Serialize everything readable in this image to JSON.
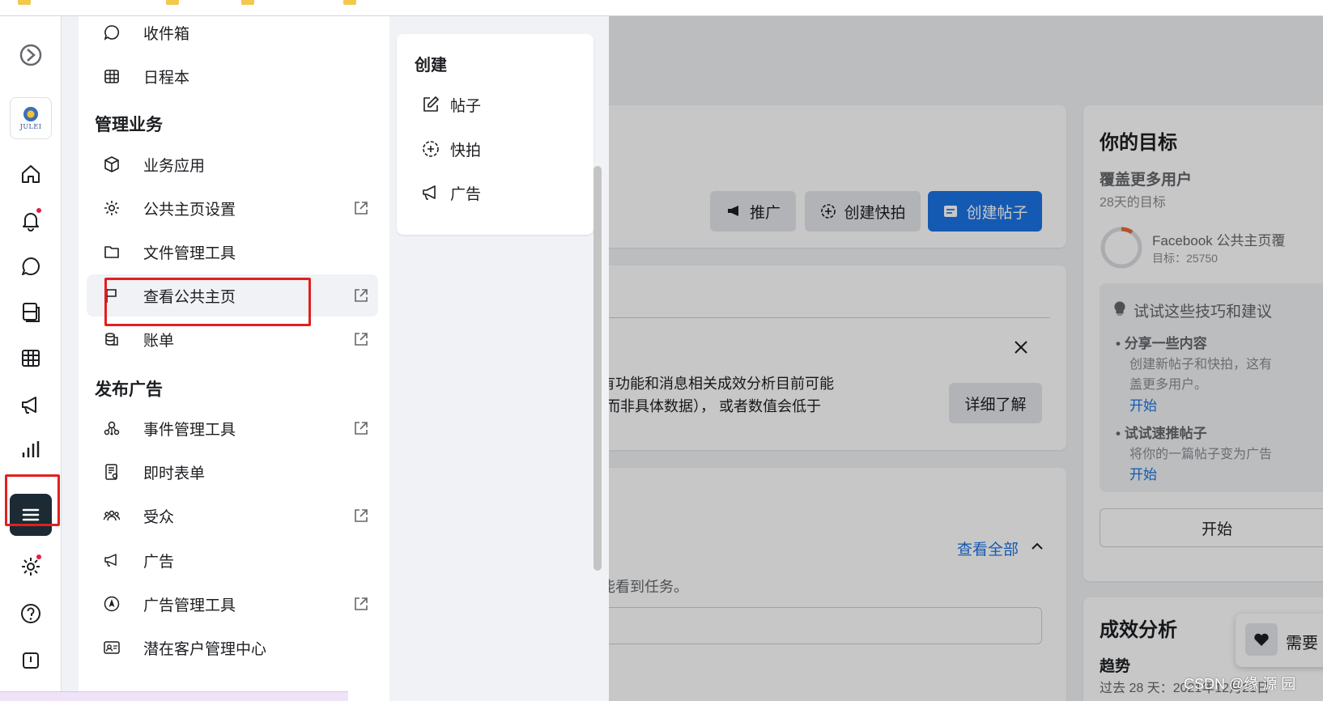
{
  "rail": {
    "items": [
      "meta-logo-icon",
      "page-avatar",
      "home-icon",
      "notifications-icon",
      "messages-icon",
      "content-icon",
      "planner-icon",
      "ads-icon",
      "insights-icon",
      "all-tools-menu-icon",
      "settings-icon",
      "help-icon",
      "report-icon"
    ],
    "avatar_brand": "JULEI"
  },
  "menu": {
    "items_top": [
      {
        "label": "收件箱",
        "icon": "inbox-icon"
      },
      {
        "label": "日程本",
        "icon": "calendar-icon"
      }
    ],
    "section_manage": "管理业务",
    "manage_items": [
      {
        "label": "业务应用",
        "icon": "cube-icon",
        "external": false
      },
      {
        "label": "公共主页设置",
        "icon": "gear-icon",
        "external": true
      },
      {
        "label": "文件管理工具",
        "icon": "folder-icon",
        "external": false
      },
      {
        "label": "查看公共主页",
        "icon": "flag-icon",
        "external": true
      },
      {
        "label": "账单",
        "icon": "billing-icon",
        "external": true
      }
    ],
    "section_ads": "发布广告",
    "ads_items": [
      {
        "label": "事件管理工具",
        "icon": "events-icon",
        "external": true
      },
      {
        "label": "即时表单",
        "icon": "form-icon",
        "external": false
      },
      {
        "label": "受众",
        "icon": "audience-icon",
        "external": true
      },
      {
        "label": "广告",
        "icon": "megaphone-icon",
        "external": false
      },
      {
        "label": "广告管理工具",
        "icon": "compass-icon",
        "external": true
      },
      {
        "label": "潜在客户管理中心",
        "icon": "contacts-icon",
        "external": false
      }
    ]
  },
  "create": {
    "title": "创建",
    "items": [
      {
        "label": "帖子",
        "icon": "edit-icon"
      },
      {
        "label": "快拍",
        "icon": "story-plus-icon"
      },
      {
        "label": "广告",
        "icon": "megaphone-icon"
      }
    ]
  },
  "main": {
    "buttons": {
      "promote": "推广",
      "create_story": "创建快拍",
      "create_post": "创建帖子"
    },
    "notice": {
      "line1": "有功能和消息相关成效分析目前可能",
      "line2": "(而非具体数据）， 或者数值会低于",
      "learn_more": "详细了解"
    },
    "tasks": {
      "view_all": "查看全部",
      "hint": "能看到任务。"
    }
  },
  "goals": {
    "title": "你的目标",
    "goal_name": "覆盖更多用户",
    "goal_period": "28天的目标",
    "goal_metric": "Facebook 公共主页覆",
    "goal_target": "目标：25750",
    "tips_title": "试试这些技巧和建议",
    "tip1_title": "分享一些内容",
    "tip1_line1": "创建新帖子和快拍，这有",
    "tip1_line2": "盖更多用户。",
    "tip1_action": "开始",
    "tip2_title": "试试速推帖子",
    "tip2_line1": "将你的一篇帖子变为广告",
    "tip2_action": "开始",
    "start_button": "开始"
  },
  "performance": {
    "title": "成效分析",
    "trend": "趋势",
    "subtitle": "过去 28 天：2021年12月21日",
    "need_help": "需要"
  },
  "watermark": "CSDN @缘  源  园"
}
